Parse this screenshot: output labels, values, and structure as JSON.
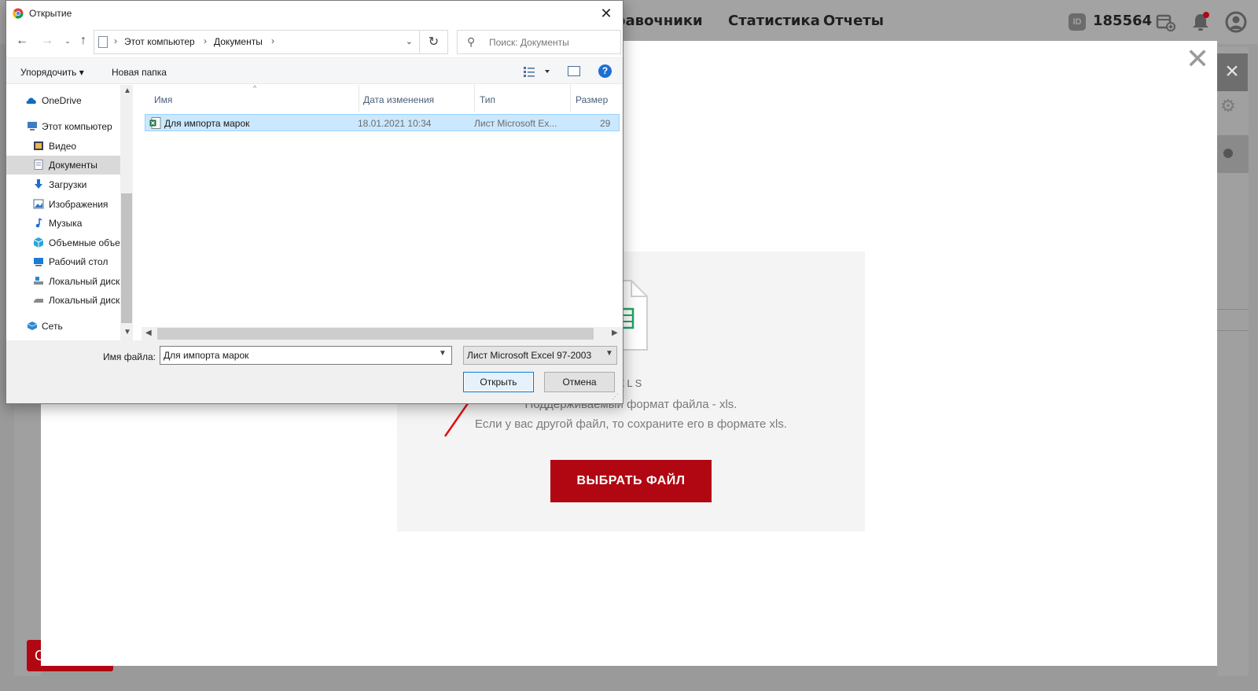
{
  "app": {
    "nav": [
      "Справочники",
      "Статистика",
      "Отчеты"
    ],
    "user_id_badge": "ID",
    "user_id": "185564",
    "stub_letter": "С"
  },
  "modal": {
    "close_glyph": "✕",
    "upload": {
      "format_caption": "XLS",
      "hint_line1": "Поддерживаемый формат файла - xls.",
      "hint_line2": "Если у вас другой файл, то сохраните его в формате xls.",
      "choose_button": "ВЫБРАТЬ ФАЙЛ"
    }
  },
  "dialog": {
    "title": "Открытие",
    "close_glyph": "✕",
    "address": [
      "Этот компьютер",
      "Документы"
    ],
    "search_placeholder": "Поиск: Документы",
    "toolbar": {
      "organize": "Упорядочить",
      "new_folder": "Новая папка",
      "help": "?"
    },
    "nav_items": [
      {
        "label": "OneDrive",
        "icon": "onedrive-icon"
      },
      {
        "label": "Этот компьютер",
        "icon": "computer-icon"
      },
      {
        "label": "Видео",
        "icon": "video-icon"
      },
      {
        "label": "Документы",
        "icon": "documents-icon",
        "selected": true
      },
      {
        "label": "Загрузки",
        "icon": "downloads-icon"
      },
      {
        "label": "Изображения",
        "icon": "images-icon"
      },
      {
        "label": "Музыка",
        "icon": "music-icon"
      },
      {
        "label": "Объемные объекты",
        "icon": "3d-objects-icon"
      },
      {
        "label": "Рабочий стол",
        "icon": "desktop-icon"
      },
      {
        "label": "Локальный диск",
        "icon": "local-disk-icon"
      },
      {
        "label": "Локальный диск",
        "icon": "local-disk-icon"
      },
      {
        "label": "Сеть",
        "icon": "network-icon"
      }
    ],
    "columns": [
      "Имя",
      "Дата изменения",
      "Тип",
      "Размер"
    ],
    "files": [
      {
        "name": "Для импорта марок",
        "modified": "18.01.2021 10:34",
        "type": "Лист Microsoft Ex...",
        "size": "29"
      }
    ],
    "filename_label": "Имя файла:",
    "filename_value": "Для импорта марок",
    "filetype": "Лист Microsoft Excel 97-2003",
    "open_button": "Открыть",
    "cancel_button": "Отмена"
  },
  "colors": {
    "brand_red": "#b10712",
    "selection_blue": "#cce8ff",
    "accent_blue": "#0078d7"
  }
}
